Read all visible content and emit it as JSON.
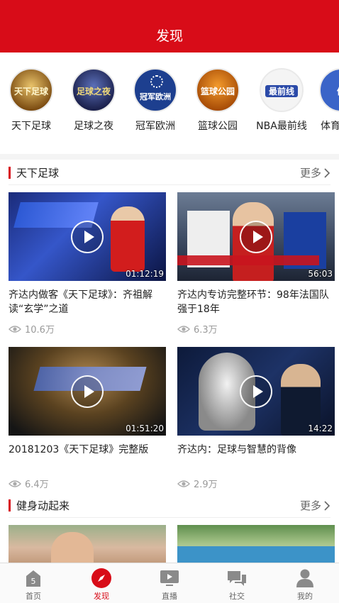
{
  "header": {
    "title": "发现"
  },
  "channels": [
    {
      "name": "天下足球",
      "logo_text": "天下足球"
    },
    {
      "name": "足球之夜",
      "logo_text": "足球之夜"
    },
    {
      "name": "冠军欧洲",
      "logo_text": "冠军欧洲"
    },
    {
      "name": "篮球公园",
      "logo_text": "篮球公园"
    },
    {
      "name": "NBA最前线",
      "logo_text": "最前线"
    },
    {
      "name": "体育",
      "logo_text": "体"
    }
  ],
  "sections": [
    {
      "title": "天下足球",
      "more": "更多",
      "videos": [
        {
          "title": "齐达内做客《天下足球》：齐祖解读“玄学”之道",
          "views": "10.6万",
          "duration": "01:12:19"
        },
        {
          "title": "齐达内专访完整环节：98年法国队强于18年",
          "views": "6.3万",
          "duration": "56:03"
        },
        {
          "title": "20181203《天下足球》完整版",
          "views": "6.4万",
          "duration": "01:51:20"
        },
        {
          "title": "齐达内：足球与智慧的背像",
          "views": "2.9万",
          "duration": "14:22"
        }
      ]
    },
    {
      "title": "健身动起来",
      "more": "更多"
    }
  ],
  "tabs": [
    {
      "label": "首页",
      "badge": "5"
    },
    {
      "label": "发现"
    },
    {
      "label": "直播"
    },
    {
      "label": "社交"
    },
    {
      "label": "我的"
    }
  ],
  "colors": {
    "brand": "#d80c18"
  }
}
